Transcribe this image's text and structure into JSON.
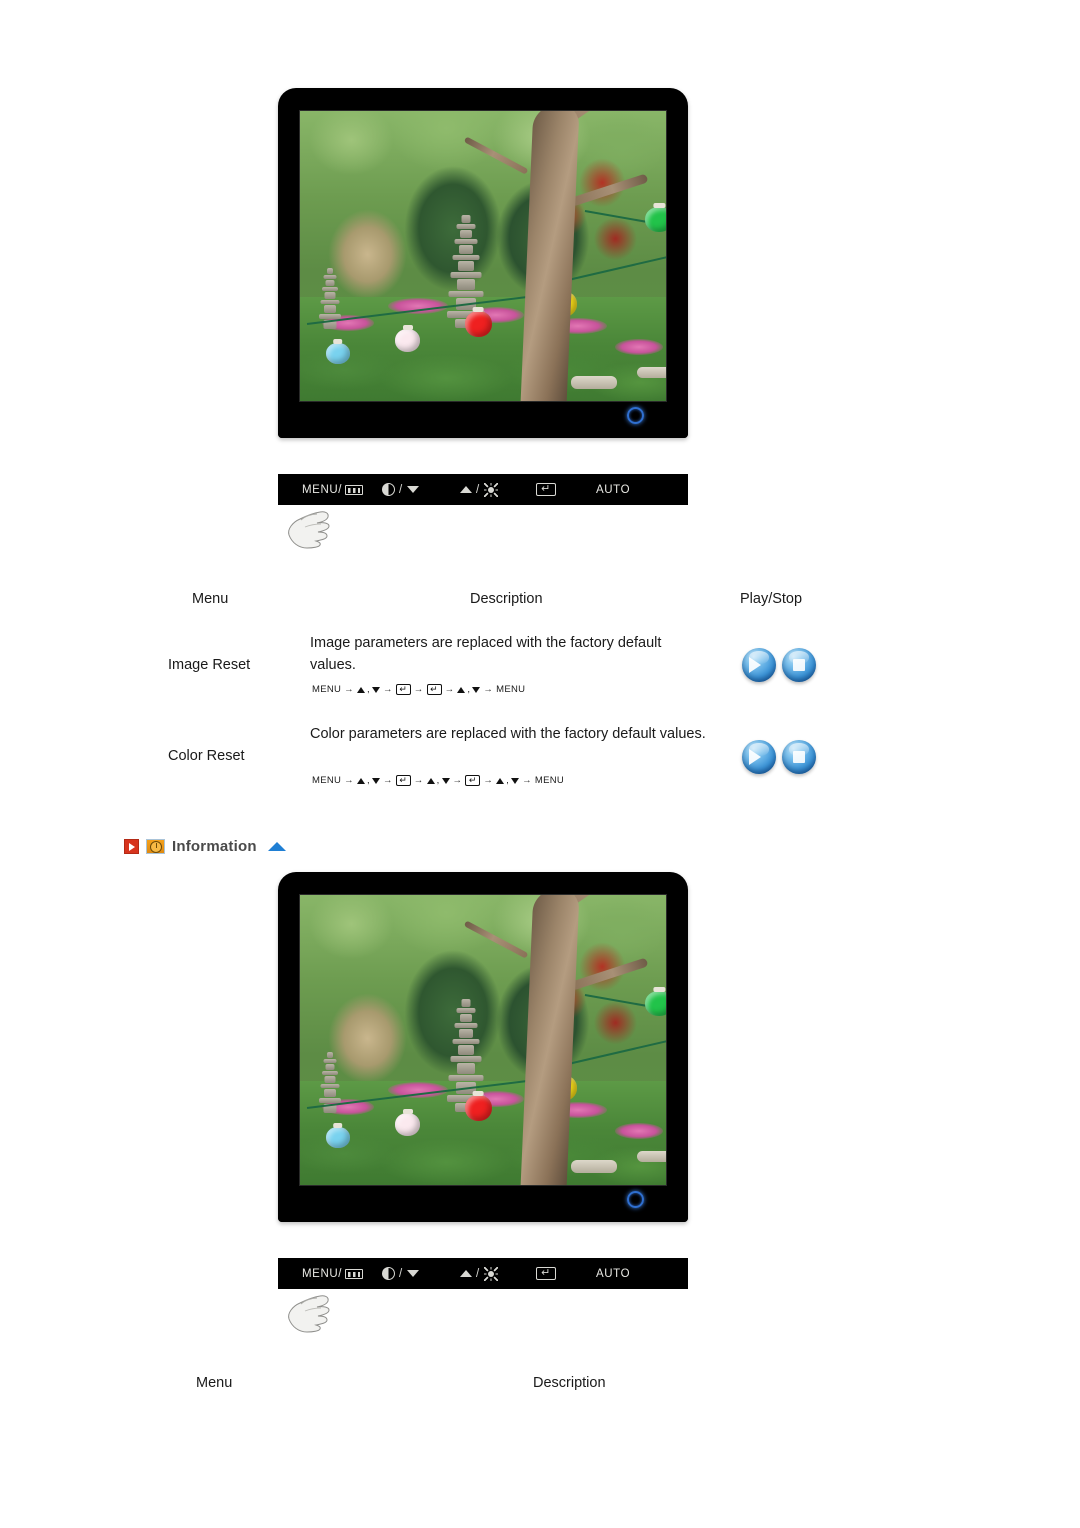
{
  "monitors": [
    {
      "id": "monitor-top",
      "screen_image": "korean-garden-pagoda-lanterns-photo",
      "power_led": "power-indicator",
      "control_bar": {
        "buttons": [
          {
            "name": "menu-button",
            "label": "MENU/",
            "icon": "osd-bars-icon"
          },
          {
            "name": "down-button",
            "label": "",
            "icon": "contrast-icon",
            "separator": "/",
            "icon2": "triangle-down-icon"
          },
          {
            "name": "up-button",
            "label": "",
            "icon": "triangle-up-icon",
            "separator": "/",
            "icon2": "brightness-icon"
          },
          {
            "name": "enter-button",
            "label": "",
            "icon": "enter-key-icon"
          },
          {
            "name": "auto-button",
            "label": "AUTO",
            "icon": ""
          }
        ]
      },
      "cursor": "hand-pointer-cursor"
    },
    {
      "id": "monitor-bottom",
      "screen_image": "korean-garden-pagoda-lanterns-photo",
      "power_led": "power-indicator",
      "control_bar": {
        "buttons": [
          {
            "name": "menu-button",
            "label": "MENU/",
            "icon": "osd-bars-icon"
          },
          {
            "name": "down-button",
            "label": "",
            "icon": "contrast-icon",
            "separator": "/",
            "icon2": "triangle-down-icon"
          },
          {
            "name": "up-button",
            "label": "",
            "icon": "triangle-up-icon",
            "separator": "/",
            "icon2": "brightness-icon"
          },
          {
            "name": "enter-button",
            "label": "",
            "icon": "enter-key-icon"
          },
          {
            "name": "auto-button",
            "label": "AUTO",
            "icon": ""
          }
        ]
      },
      "cursor": "hand-pointer-cursor"
    }
  ],
  "table_reset": {
    "headers": {
      "menu": "Menu",
      "description": "Description",
      "playstop": "Play/Stop"
    },
    "rows": [
      {
        "menu": "Image Reset",
        "description": "Image parameters are replaced with the factory default values.",
        "keys": [
          "MENU",
          "▲ , ▼",
          "ENTER",
          "ENTER",
          "▲ , ▼",
          "MENU"
        ],
        "key_sequence_text": "MENU → ▲ , ▼ → ↵ → ↵ → ▲ , ▼ → MENU",
        "play_label": "play-button",
        "stop_label": "stop-button"
      },
      {
        "menu": "Color Reset",
        "description": "Color parameters are replaced with the factory default values.",
        "keys": [
          "MENU",
          "▲ , ▼",
          "ENTER",
          "▲ , ▼",
          "ENTER",
          "▲ , ▼",
          "MENU"
        ],
        "key_sequence_text": "MENU → ▲ , ▼ → ↵ → ▲ , ▼ → ↵ → ▲ , ▼ → MENU",
        "play_label": "play-button",
        "stop_label": "stop-button"
      }
    ]
  },
  "information_section": {
    "title": "Information",
    "red_icon": "play-marker-icon",
    "clock_icon": "information-clock-icon",
    "collapse_icon": "triangle-up-collapse-icon"
  },
  "table_information": {
    "headers": {
      "menu": "Menu",
      "description": "Description"
    }
  },
  "colors": {
    "accent_blue": "#1f7fd4",
    "icon_red": "#d7341d",
    "icon_orange": "#f4a11c",
    "title_gray": "#4a4a4a",
    "bezel_black": "#000000",
    "text": "#1a1a1a"
  }
}
